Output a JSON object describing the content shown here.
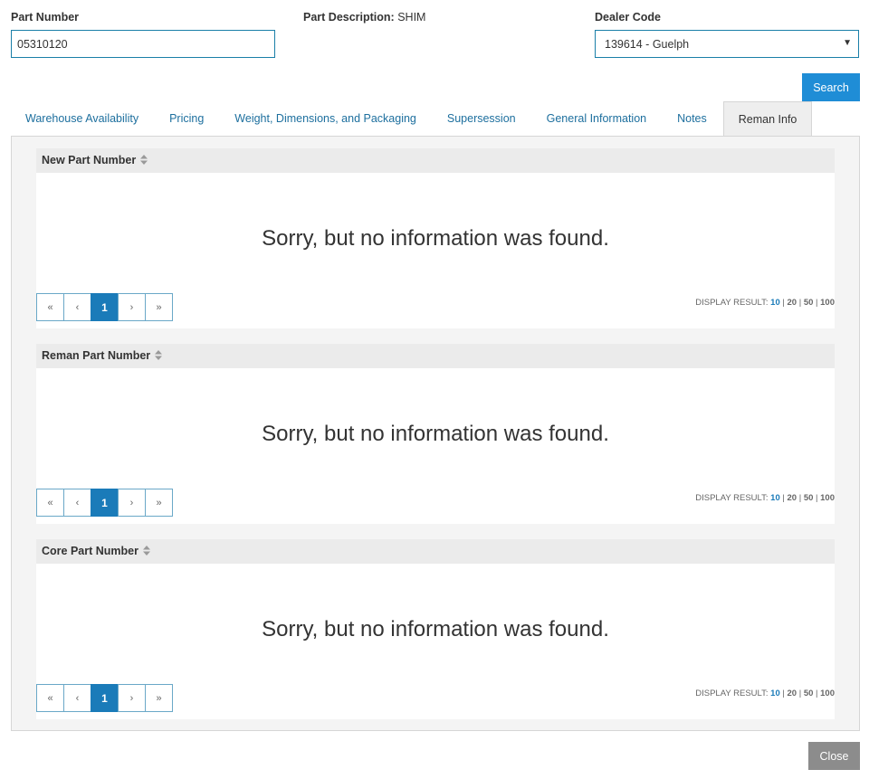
{
  "form": {
    "part_number_label": "Part Number",
    "part_number_value": "05310120",
    "part_description_label": "Part Description:",
    "part_description_value": "SHIM",
    "dealer_code_label": "Dealer Code",
    "dealer_code_value": "139614 - Guelph"
  },
  "buttons": {
    "search": "Search",
    "close": "Close"
  },
  "tabs": [
    {
      "label": "Warehouse Availability"
    },
    {
      "label": "Pricing"
    },
    {
      "label": "Weight, Dimensions, and Packaging"
    },
    {
      "label": "Supersession"
    },
    {
      "label": "General Information"
    },
    {
      "label": "Notes"
    },
    {
      "label": "Reman Info",
      "active": true
    }
  ],
  "grids": [
    {
      "header": "New Part Number",
      "empty_message": "Sorry, but no information was found."
    },
    {
      "header": "Reman Part Number",
      "empty_message": "Sorry, but no information was found."
    },
    {
      "header": "Core Part Number",
      "empty_message": "Sorry, but no information was found."
    }
  ],
  "pager": {
    "first": "«",
    "prev": "‹",
    "current": "1",
    "next": "›",
    "last": "»",
    "display_label": "DISPLAY RESULT:",
    "sizes": [
      "10",
      "20",
      "50",
      "100"
    ],
    "selected_size": "10",
    "separator": "|"
  },
  "icons": {
    "sort": "sort-icon",
    "dropdown": "caret-down-icon"
  },
  "colors": {
    "accent": "#1f8dd6",
    "link": "#1d6f9e",
    "close_button": "#8c8c8c"
  }
}
